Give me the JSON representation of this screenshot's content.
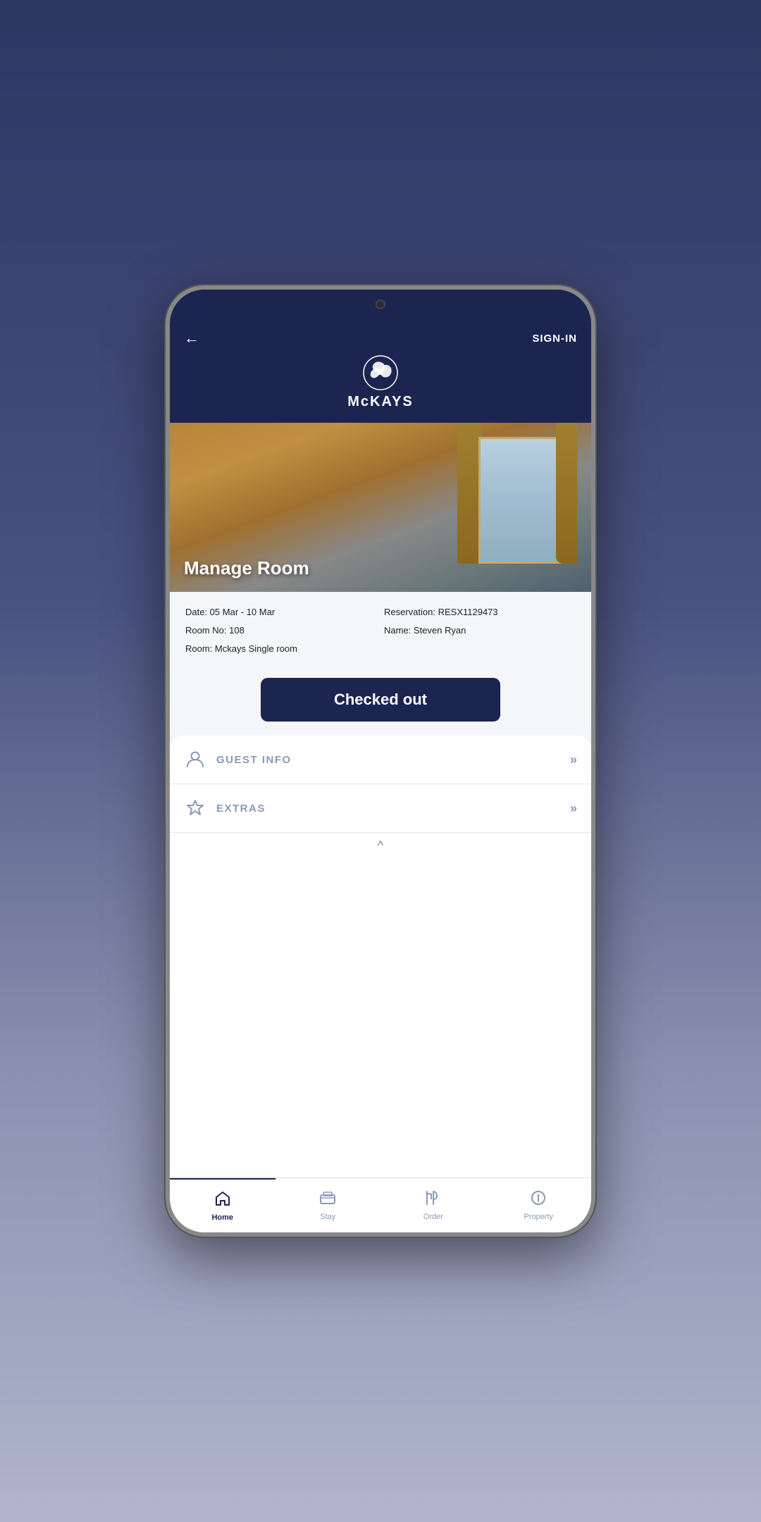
{
  "background": {
    "gradient_start": "#2d3561",
    "gradient_end": "#b0b5cc"
  },
  "header": {
    "back_label": "←",
    "sign_in_label": "SIGN-IN",
    "logo_text": "McKAYS",
    "logo_icon": "triskelion"
  },
  "hero": {
    "title": "Manage Room"
  },
  "reservation": {
    "date_label": "Date: 05 Mar - 10 Mar",
    "room_no_label": "Room No: 108",
    "room_name_label": "Room:  Mckays Single room",
    "reservation_label": "Reservation: RESX1129473",
    "name_label": "Name: Steven Ryan"
  },
  "checkout": {
    "button_label": "Checked out"
  },
  "menu": {
    "items": [
      {
        "id": "guest-info",
        "label": "GUEST INFO",
        "icon": "person-icon",
        "arrow": "»"
      },
      {
        "id": "extras",
        "label": "EXTRAS",
        "icon": "star-icon",
        "arrow": "»"
      }
    ]
  },
  "bottom_nav": {
    "items": [
      {
        "id": "home",
        "label": "Home",
        "icon": "🏠",
        "active": true
      },
      {
        "id": "stay",
        "label": "Stay",
        "icon": "🛏",
        "active": false
      },
      {
        "id": "order",
        "label": "Order",
        "icon": "🍴",
        "active": false
      },
      {
        "id": "property",
        "label": "Property",
        "icon": "ℹ",
        "active": false
      }
    ]
  }
}
